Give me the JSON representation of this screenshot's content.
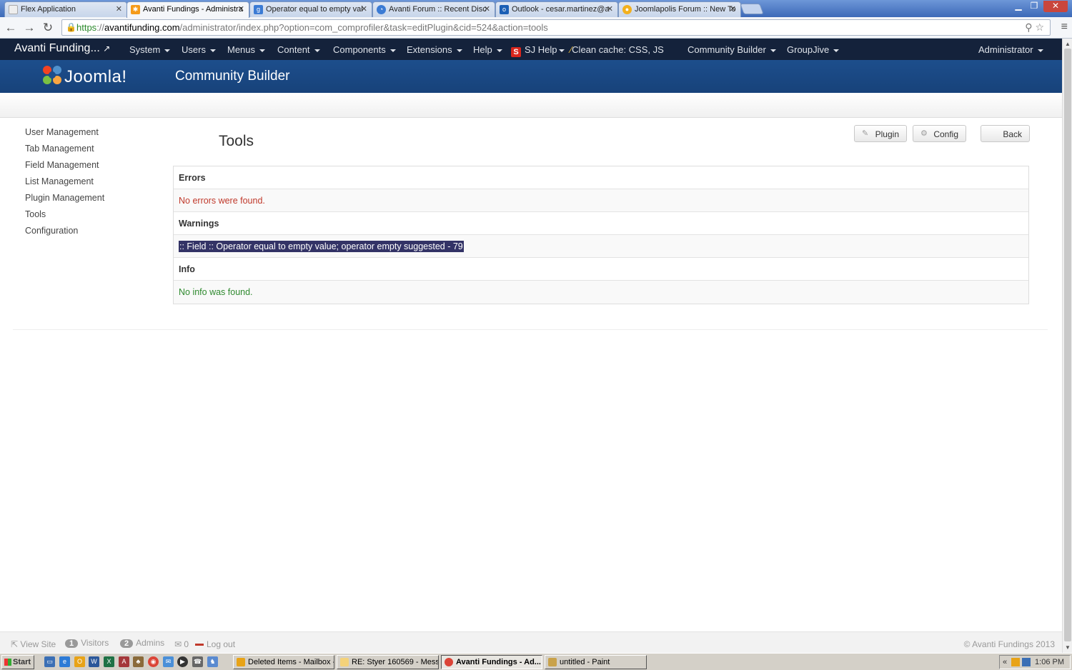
{
  "browser": {
    "tabs": [
      {
        "title": "Flex Application",
        "icon_color": "#eeeeee"
      },
      {
        "title": "Avanti Fundings - Administra",
        "icon_color": "#f59b1a"
      },
      {
        "title": "Operator equal to empty val",
        "icon_color": "#3b7bd4"
      },
      {
        "title": "Avanti Forum :: Recent Disc",
        "icon_color": "#3b7bd4"
      },
      {
        "title": "Outlook - cesar.martinez@a",
        "icon_color": "#1b5fb5"
      },
      {
        "title": "Joomlapolis Forum :: New To",
        "icon_color": "#f2b01e"
      }
    ],
    "url_scheme": "https",
    "url_host": "avantifunding.com",
    "url_path": "/administrator/index.php?option=com_comprofiler&task=editPlugin&cid=524&action=tools"
  },
  "adminbar": {
    "brand": "Avanti Funding...",
    "menus": [
      "System",
      "Users",
      "Menus",
      "Content",
      "Components",
      "Extensions",
      "Help"
    ],
    "sj_help": "SJ Help",
    "clean_cache": "Clean cache: CSS, JS",
    "community_builder": "Community Builder",
    "groupjive": "GroupJive",
    "administrator": "Administrator"
  },
  "header": {
    "logo_text": "Joomla!",
    "title": "Community Builder"
  },
  "sidebar": [
    "User Management",
    "Tab Management",
    "Field Management",
    "List Management",
    "Plugin Management",
    "Tools",
    "Configuration"
  ],
  "page": {
    "title": "Tools",
    "buttons": {
      "plugin": "Plugin",
      "config": "Config",
      "back": "Back"
    }
  },
  "results": {
    "errors_heading": "Errors",
    "errors_text": "No errors were found.",
    "warnings_heading": "Warnings",
    "warnings_text": ":: Field :: Operator equal to empty value; operator empty suggested - 79",
    "info_heading": "Info",
    "info_text": "No info was found."
  },
  "footer": {
    "view_site": "View Site",
    "visitors_count": "1",
    "visitors_label": "Visitors",
    "admins_count": "2",
    "admins_label": "Admins",
    "messages_count": "0",
    "logout": "Log out",
    "copyright": "© Avanti Fundings 2013"
  },
  "taskbar": {
    "start": "Start",
    "tasks": [
      {
        "label": "Deleted Items - Mailbox -...",
        "active": false
      },
      {
        "label": "RE: Styer 160569 - Mess...",
        "active": false
      },
      {
        "label": "Avanti Fundings - Ad...",
        "active": true
      },
      {
        "label": "untitled - Paint",
        "active": false
      }
    ],
    "clock": "1:06 PM"
  },
  "colors": {
    "navbar": "#14223b",
    "header": "#1d4e8c",
    "error": "#c0392b",
    "success": "#2f8a2f",
    "selection": "#333366"
  }
}
